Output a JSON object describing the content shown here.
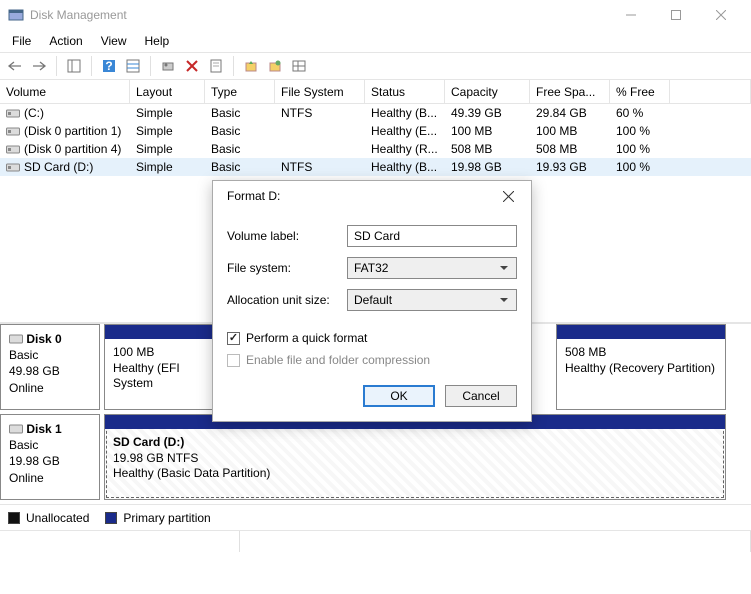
{
  "window": {
    "title": "Disk Management"
  },
  "menu": {
    "file": "File",
    "action": "Action",
    "view": "View",
    "help": "Help"
  },
  "columns": {
    "volume": "Volume",
    "layout": "Layout",
    "type": "Type",
    "filesystem": "File System",
    "status": "Status",
    "capacity": "Capacity",
    "free": "Free Spa...",
    "pctfree": "% Free"
  },
  "volumes": [
    {
      "name": "(C:)",
      "layout": "Simple",
      "type": "Basic",
      "fs": "NTFS",
      "status": "Healthy (B...",
      "cap": "49.39 GB",
      "free": "29.84 GB",
      "pct": "60 %"
    },
    {
      "name": "(Disk 0 partition 1)",
      "layout": "Simple",
      "type": "Basic",
      "fs": "",
      "status": "Healthy (E...",
      "cap": "100 MB",
      "free": "100 MB",
      "pct": "100 %"
    },
    {
      "name": "(Disk 0 partition 4)",
      "layout": "Simple",
      "type": "Basic",
      "fs": "",
      "status": "Healthy (R...",
      "cap": "508 MB",
      "free": "508 MB",
      "pct": "100 %"
    },
    {
      "name": "SD Card (D:)",
      "layout": "Simple",
      "type": "Basic",
      "fs": "NTFS",
      "status": "Healthy (B...",
      "cap": "19.98 GB",
      "free": "19.93 GB",
      "pct": "100 %"
    }
  ],
  "disks": [
    {
      "name": "Disk 0",
      "type": "Basic",
      "size": "49.98 GB",
      "state": "Online",
      "parts": [
        {
          "title": "",
          "line1": "100 MB",
          "line2": "Healthy (EFI System",
          "flex": 110
        },
        {
          "title": "",
          "line1": "",
          "line2": "",
          "flex": 342,
          "hidden": true
        },
        {
          "title": "",
          "line1": "508 MB",
          "line2": "Healthy (Recovery Partition)",
          "flex": 170
        }
      ]
    },
    {
      "name": "Disk 1",
      "type": "Basic",
      "size": "19.98 GB",
      "state": "Online",
      "parts": [
        {
          "title": "SD Card  (D:)",
          "line1": "19.98 GB NTFS",
          "line2": "Healthy (Basic Data Partition)",
          "flex": 622,
          "hatched": true,
          "selected": true
        }
      ]
    }
  ],
  "legend": {
    "unallocated": "Unallocated",
    "primary": "Primary partition"
  },
  "dialog": {
    "title": "Format D:",
    "labels": {
      "volume": "Volume label:",
      "fs": "File system:",
      "aus": "Allocation unit size:"
    },
    "values": {
      "volume": "SD Card",
      "fs": "FAT32",
      "aus": "Default"
    },
    "quickformat": "Perform a quick format",
    "compress": "Enable file and folder compression",
    "ok": "OK",
    "cancel": "Cancel"
  }
}
